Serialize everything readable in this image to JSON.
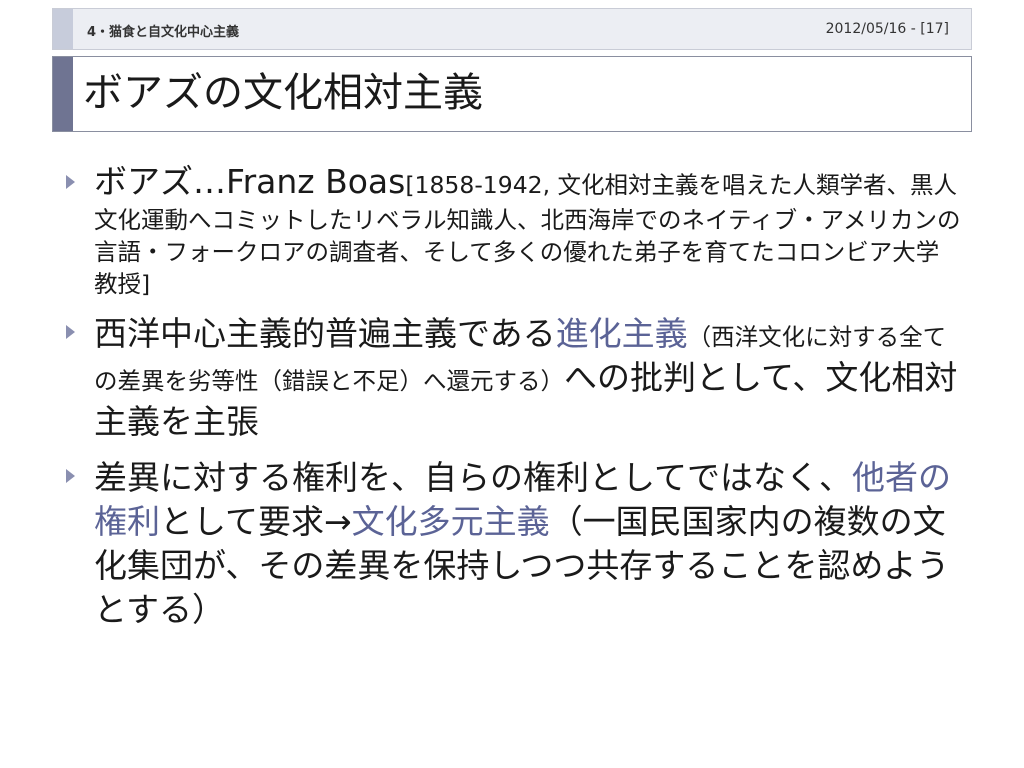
{
  "header": {
    "section": "4・猫食と自文化中心主義",
    "date_page": "2012/05/16 - [17]"
  },
  "title": "ボアズの文化相対主義",
  "bullets": {
    "b1": {
      "lead": "ボアズ…Franz Boas",
      "detail": "[1858-1942, 文化相対主義を唱えた人類学者、黒人文化運動へコミットしたリベラル知識人、北西海岸でのネイティブ・アメリカンの言語・フォークロアの調査者、そして多くの優れた弟子を育てたコロンビア大学教授]"
    },
    "b2": {
      "lead": "西洋中心主義的普遍主義である",
      "highlight": "進化主義",
      "paren": "（西洋文化に対する全ての差異を劣等性（錯誤と不足）へ還元する）",
      "tail": "への批判として、文化相対主義を主張"
    },
    "b3": {
      "lead": "差異に対する権利を、自らの権利としてではなく、",
      "highlight1": "他者の権利",
      "mid": "として要求→",
      "highlight2": "文化多元主義",
      "paren": "（一国民国家内の複数の文化集団が、その差異を保持しつつ共存することを認めようとする）"
    }
  },
  "colors": {
    "accent_text": "#5b6396",
    "title_accent": "#6f7492",
    "header_bg": "#eceef3"
  }
}
